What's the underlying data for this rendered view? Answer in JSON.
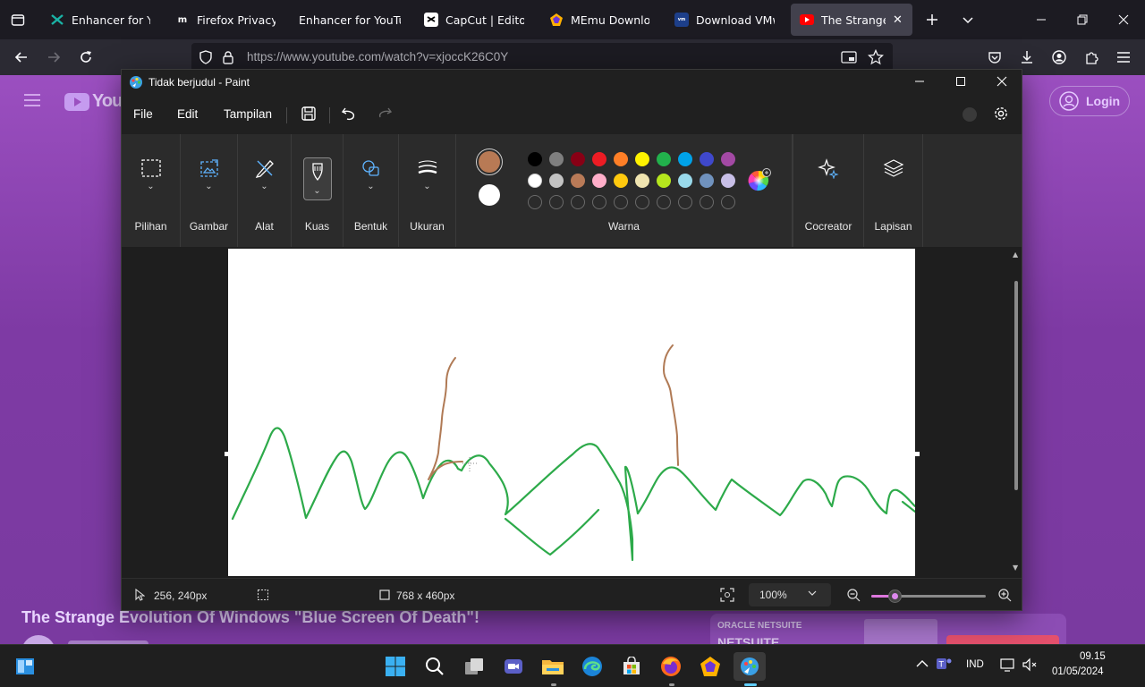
{
  "browser": {
    "tabs": [
      {
        "label": "Enhancer for YouT",
        "icon": "enhancer-icon",
        "active": false
      },
      {
        "label": "Firefox Privacy No",
        "icon": "mozilla-icon",
        "active": false
      },
      {
        "label": "Enhancer for YouTube",
        "icon": "firefox-icon",
        "active": false
      },
      {
        "label": "CapCut | Editor vid",
        "icon": "capcut-icon",
        "active": false
      },
      {
        "label": "MEmu Download",
        "icon": "memu-icon",
        "active": false
      },
      {
        "label": "Download VMwar",
        "icon": "vmware-icon",
        "active": false
      },
      {
        "label": "The Strange Ev",
        "icon": "youtube-icon",
        "active": true
      }
    ],
    "url": "https://www.youtube.com/watch?v=xjoccK26C0Y"
  },
  "youtube": {
    "video_title": "The Strange Evolution Of Windows \"Blue Screen Of Death\"!",
    "login_label": "Login",
    "logo_text": "YouT",
    "ad_brand": "ORACLE NETSUITE",
    "ad_text": "NETSUITE"
  },
  "paint": {
    "window_title": "Tidak berjudul - Paint",
    "menu": [
      "File",
      "Edit",
      "Tampilan"
    ],
    "ribbon": {
      "selection": "Pilihan",
      "image": "Gambar",
      "tools": "Alat",
      "brushes": "Kuas",
      "shapes": "Bentuk",
      "size": "Ukuran",
      "colors": "Warna",
      "cocreator": "Cocreator",
      "layers": "Lapisan"
    },
    "primary_color": "#b87a55",
    "secondary_color": "#ffffff",
    "palette_row1": [
      "#000000",
      "#7f7f7f",
      "#880015",
      "#ed1c24",
      "#ff7f27",
      "#fff200",
      "#22b14c",
      "#00a2e8",
      "#3f48cc",
      "#a349a4"
    ],
    "palette_row2": [
      "#ffffff",
      "#c3c3c3",
      "#b97a57",
      "#ffaec9",
      "#ffc90e",
      "#efe4b0",
      "#b5e61d",
      "#99d9ea",
      "#7092be",
      "#c8bfe7"
    ],
    "status": {
      "cursor_pos": "256, 240px",
      "canvas_size": "768 x 460px",
      "zoom": "100%"
    },
    "zoom_level_percent": 100
  },
  "taskbar": {
    "language": "IND",
    "time": "09.15",
    "date": "01/05/2024"
  },
  "colors": {
    "stroke_green": "#2daa4a",
    "stroke_brown": "#b07a55",
    "accent": "#0078d4"
  }
}
